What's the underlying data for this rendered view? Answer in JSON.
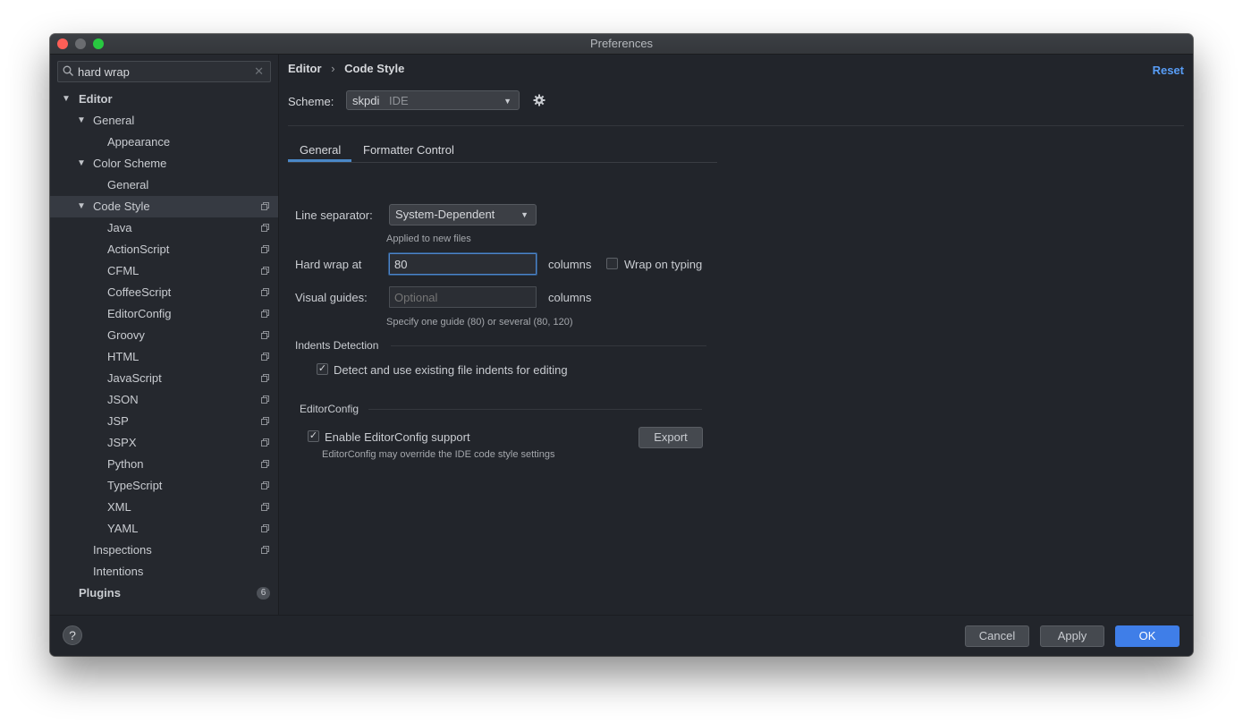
{
  "window": {
    "title": "Preferences"
  },
  "search": {
    "value": "hard wrap",
    "clear_icon": "✕"
  },
  "sidebar": {
    "items": [
      {
        "label": "Editor",
        "expand": "▼"
      },
      {
        "label": "General",
        "expand": "▼"
      },
      {
        "label": "Appearance"
      },
      {
        "label": "Color Scheme",
        "expand": "▼"
      },
      {
        "label": "General"
      },
      {
        "label": "Code Style",
        "expand": "▼"
      },
      {
        "label": "Java"
      },
      {
        "label": "ActionScript"
      },
      {
        "label": "CFML"
      },
      {
        "label": "CoffeeScript"
      },
      {
        "label": "EditorConfig"
      },
      {
        "label": "Groovy"
      },
      {
        "label": "HTML"
      },
      {
        "label": "JavaScript"
      },
      {
        "label": "JSON"
      },
      {
        "label": "JSP"
      },
      {
        "label": "JSPX"
      },
      {
        "label": "Python"
      },
      {
        "label": "TypeScript"
      },
      {
        "label": "XML"
      },
      {
        "label": "YAML"
      },
      {
        "label": "Inspections"
      },
      {
        "label": "Intentions"
      },
      {
        "label": "Plugins",
        "badge": "6"
      }
    ]
  },
  "breadcrumb": {
    "parent": "Editor",
    "separator": "›",
    "current": "Code Style"
  },
  "reset_label": "Reset",
  "scheme": {
    "label": "Scheme:",
    "name": "skpdi",
    "type": "IDE"
  },
  "tabs": [
    {
      "label": "General"
    },
    {
      "label": "Formatter Control"
    }
  ],
  "form": {
    "line_separator": {
      "label": "Line separator:",
      "value": "System-Dependent",
      "hint": "Applied to new files"
    },
    "hard_wrap": {
      "label": "Hard wrap at",
      "value": "80",
      "unit": "columns",
      "wrap_on_typing": "Wrap on typing"
    },
    "visual_guides": {
      "label": "Visual guides:",
      "placeholder": "Optional",
      "unit": "columns",
      "hint": "Specify one guide (80) or several (80, 120)"
    }
  },
  "indents": {
    "title": "Indents Detection",
    "checkbox": "Detect and use existing file indents for editing",
    "checked": true
  },
  "editorconfig": {
    "title": "EditorConfig",
    "checkbox": "Enable EditorConfig support",
    "checked": true,
    "hint": "EditorConfig may override the IDE code style settings",
    "export_label": "Export"
  },
  "footer": {
    "help": "?",
    "cancel": "Cancel",
    "apply": "Apply",
    "ok": "OK"
  },
  "colors": {
    "accent": "#3f7ee8",
    "link": "#589df6",
    "background": "#22252b",
    "selection": "#363a42"
  },
  "icons": {
    "check": "✓",
    "dropdown": "▼"
  }
}
